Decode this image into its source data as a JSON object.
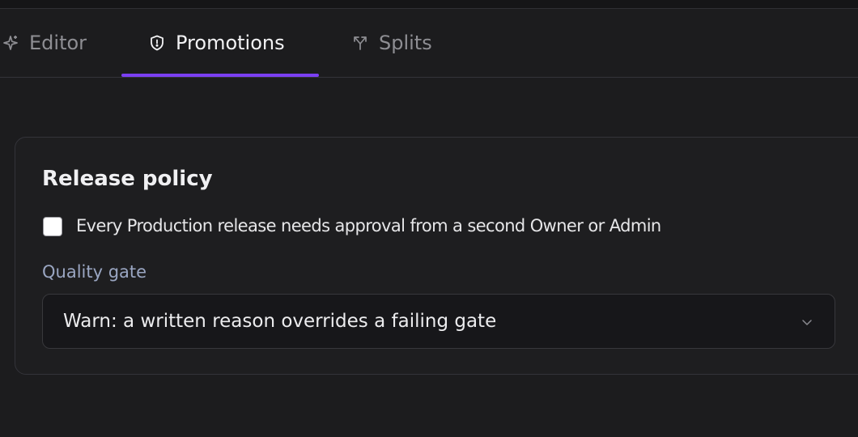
{
  "tabs": {
    "editor": {
      "label": "Editor",
      "icon": "sparkle-icon"
    },
    "promotions": {
      "label": "Promotions",
      "icon": "shield-icon",
      "active": true
    },
    "splits": {
      "label": "Splits",
      "icon": "split-arrows-icon"
    }
  },
  "accent_color": "#7b3ff2",
  "release_policy": {
    "title": "Release policy",
    "approval_checkbox": {
      "label": "Every Production release needs approval from a second Owner or Admin",
      "checked": false
    },
    "quality_gate": {
      "label": "Quality gate",
      "selected": "Warn: a written reason overrides a failing gate",
      "icon": "chevron-down-icon"
    }
  }
}
